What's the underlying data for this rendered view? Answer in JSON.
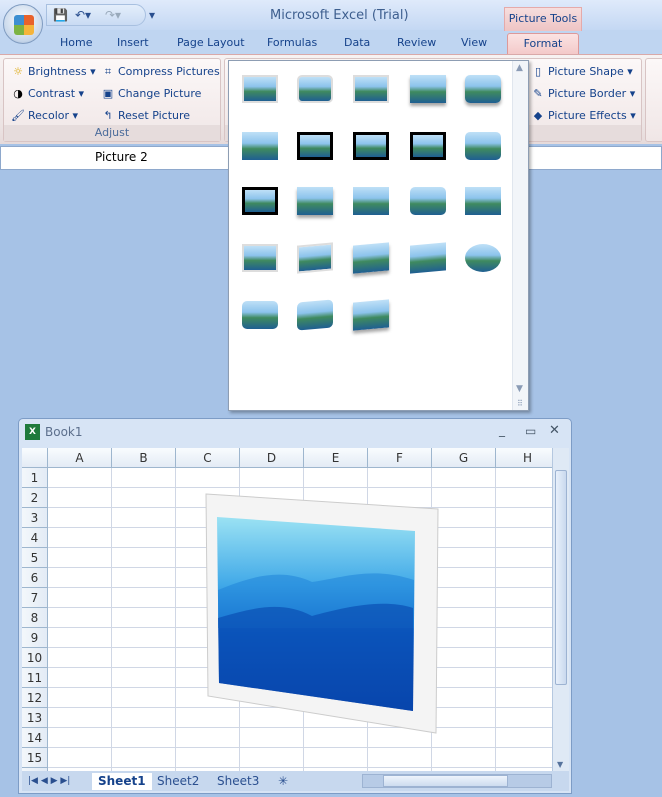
{
  "app": {
    "title": "Microsoft Excel (Trial)",
    "context_tab_group": "Picture Tools"
  },
  "tabs": [
    "Home",
    "Insert",
    "Page Layout",
    "Formulas",
    "Data",
    "Review",
    "View",
    "Format"
  ],
  "active_tab": "Format",
  "adjust_group": {
    "label": "Adjust",
    "buttons": [
      {
        "label": "Brightness",
        "icon": "sun-icon",
        "dropdown": true
      },
      {
        "label": "Contrast",
        "icon": "contrast-icon",
        "dropdown": true
      },
      {
        "label": "Recolor",
        "icon": "recolor-icon",
        "dropdown": true
      },
      {
        "label": "Compress Pictures",
        "icon": "compress-icon"
      },
      {
        "label": "Change Picture",
        "icon": "change-picture-icon"
      },
      {
        "label": "Reset Picture",
        "icon": "reset-picture-icon"
      }
    ]
  },
  "styles_group": {
    "buttons": [
      {
        "label": "Picture Shape",
        "icon": "shape-icon"
      },
      {
        "label": "Picture Border",
        "icon": "pencil-icon"
      },
      {
        "label": "Picture Effects",
        "icon": "effects-icon"
      }
    ]
  },
  "name_box": "Picture 2",
  "gallery": {
    "styles": [
      "simple-frame-white",
      "beveled-matte-white",
      "metal-frame",
      "drop-shadow-rectangle",
      "reflected-rounded",
      "soft-edge",
      "double-frame-black",
      "thick-matte-black",
      "simple-frame-black",
      "bevel-oval",
      "compound-frame-black",
      "center-shadow-rectangle",
      "soft-edge-rectangle",
      "rounded-diagonal-corner",
      "snip-diagonal-corner",
      "moderate-frame-white",
      "rotated-white",
      "perspective-shadow",
      "relaxed-perspective",
      "soft-edge-oval",
      "bevel-rectangle",
      "bevel-perspective",
      "reflected-perspective-right",
      "bevel-perspective-left",
      "reflected-bevel-black",
      "reflected-bevel-white",
      "metal-rounded",
      "metal-oval"
    ],
    "selected_index": 23
  },
  "workbook": {
    "title": "Book1",
    "columns": [
      "A",
      "B",
      "C",
      "D",
      "E",
      "F",
      "G",
      "H"
    ],
    "rows": [
      "1",
      "2",
      "3",
      "4",
      "5",
      "6",
      "7",
      "8",
      "9",
      "10",
      "11",
      "12",
      "13",
      "14",
      "15"
    ],
    "sheets": [
      "Sheet1",
      "Sheet2",
      "Sheet3"
    ],
    "active_sheet": "Sheet1"
  }
}
